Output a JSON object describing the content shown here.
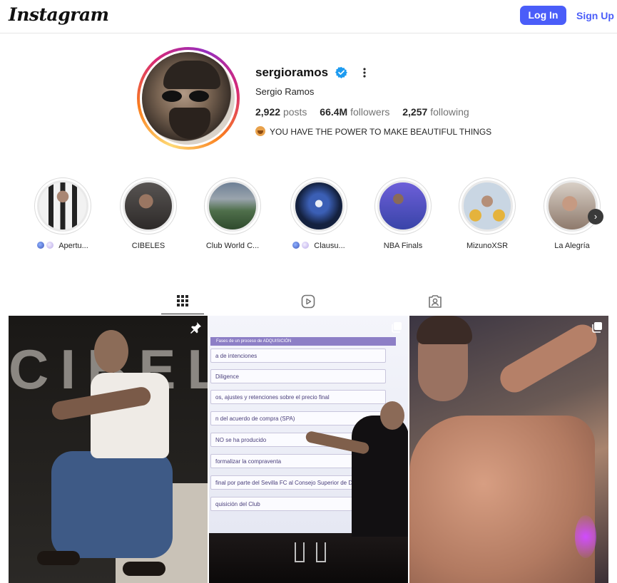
{
  "topbar": {
    "logo": "Instagram",
    "login_label": "Log In",
    "signup_label": "Sign Up"
  },
  "profile": {
    "username": "sergioramos",
    "verified": true,
    "full_name": "Sergio Ramos",
    "stats": {
      "posts_value": "2,922",
      "posts_label": "posts",
      "followers_value": "66.4M",
      "followers_label": "followers",
      "following_value": "2,257",
      "following_label": "following"
    },
    "bio": "YOU HAVE THE POWER TO MAKE BEAUTIFUL THINGS",
    "bio_emoji": "lion-face-emoji"
  },
  "highlights": [
    {
      "label": "Apertu...",
      "has_emoji_prefix": true
    },
    {
      "label": "CIBELES",
      "has_emoji_prefix": false
    },
    {
      "label": "Club World C...",
      "has_emoji_prefix": false
    },
    {
      "label": "Clausu...",
      "has_emoji_prefix": true
    },
    {
      "label": "NBA Finals",
      "has_emoji_prefix": false
    },
    {
      "label": "MizunoXSR",
      "has_emoji_prefix": false
    },
    {
      "label": "La Alegría",
      "has_emoji_prefix": false
    }
  ],
  "tabs": [
    {
      "icon": "grid-icon",
      "active": true
    },
    {
      "icon": "reels-icon",
      "active": false
    },
    {
      "icon": "tagged-icon",
      "active": false
    }
  ],
  "posts": [
    {
      "type": "pinned",
      "big_text": "CIBELES"
    },
    {
      "type": "carousel",
      "screen_title": "Fases de un proceso de ADQUISICIÓN",
      "rows": [
        "a de intenciones",
        "Diligence",
        "os, ajustes y retenciones sobre el precio final",
        "n del acuerdo de compra (SPA)",
        "NO se ha producido",
        "formalizar la compraventa",
        "final por parte del Sevilla FC al Consejo Superior de Depo",
        "quisición del Club"
      ]
    },
    {
      "type": "carousel"
    }
  ],
  "colors": {
    "accent": "#4a5df9",
    "text": "#262626",
    "muted": "#737373",
    "verified": "#1d9bf0"
  }
}
